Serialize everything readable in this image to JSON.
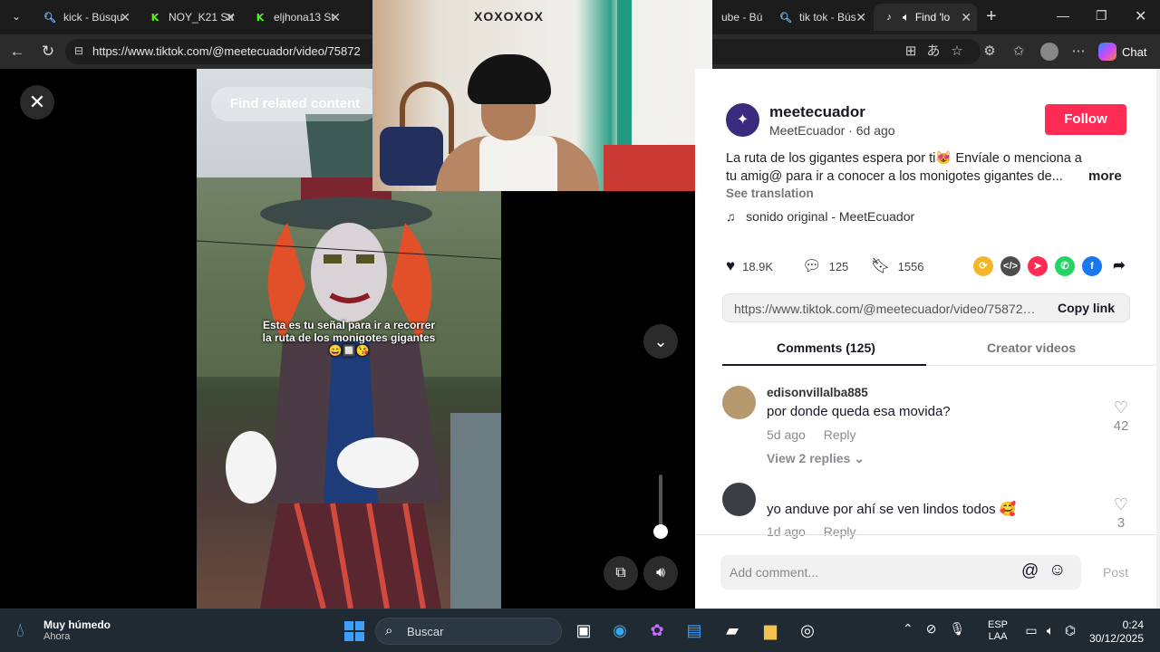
{
  "tabs": [
    {
      "label": "kick - Búsqu",
      "icon": "search-icon"
    },
    {
      "label": "NOY_K21 Str",
      "icon": "kick-icon"
    },
    {
      "label": "eljhona13 St",
      "icon": "kick-icon"
    },
    {
      "label": "ube - Bú",
      "icon": "search-icon"
    },
    {
      "label": "tik tok - Bús",
      "icon": "search-icon"
    },
    {
      "label": "Find 'lo",
      "icon": "tiktok-icon"
    }
  ],
  "address": {
    "url": "https://www.tiktok.com/@meetecuador/video/75872"
  },
  "browser": {
    "chat_label": "Chat"
  },
  "video": {
    "find_related": "Find related content",
    "caption_line1": "Esta es tu señal para ir a recorrer",
    "caption_line2": "la ruta de los monigotes gigantes",
    "caption_emojis": "😄🔲😘",
    "webcam_tag": "XOXOXOX",
    "volume_level": 0.1
  },
  "post": {
    "username": "meetecuador",
    "display_name": "MeetEcuador",
    "age": "6d ago",
    "follow_label": "Follow",
    "description": "La ruta de los gigantes espera por ti😻 Envíale o menciona a tu amig@ para ir a conocer a los monigotes gigantes de...",
    "more_label": "more",
    "see_translation": "See translation",
    "music": "sonido original - MeetEcuador",
    "likes": "18.9K",
    "comments_count": "125",
    "saves": "1556",
    "link": "https://www.tiktok.com/@meetecuador/video/7587210...",
    "copy_link": "Copy link",
    "tab_comments": "Comments (125)",
    "tab_creator": "Creator videos"
  },
  "comments": [
    {
      "user": "edisonvillalba885",
      "text": "por donde queda esa movida?",
      "age": "5d ago",
      "reply": "Reply",
      "likes": "42",
      "view_replies": "View 2 replies"
    },
    {
      "user": "",
      "text": "yo anduve por ahí se ven lindos todos 🥰",
      "age": "1d ago",
      "reply": "Reply",
      "likes": "3"
    }
  ],
  "composer": {
    "placeholder": "Add comment...",
    "post_label": "Post"
  },
  "taskbar": {
    "weather_title": "Muy húmedo",
    "weather_sub": "Ahora",
    "search_label": "Buscar",
    "lang_line1": "ESP",
    "lang_line2": "LAA",
    "time": "0:24",
    "date": "30/12/2025"
  }
}
